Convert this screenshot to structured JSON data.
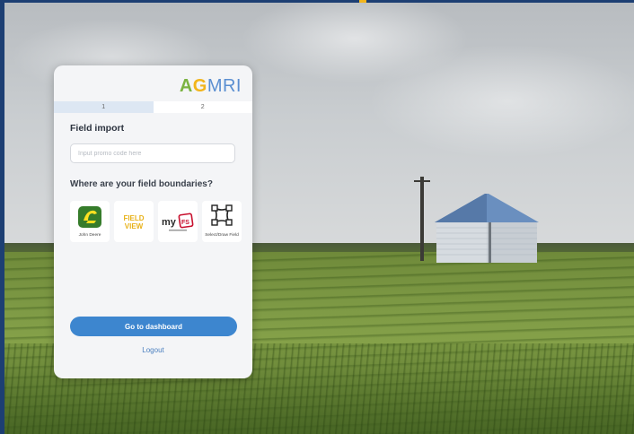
{
  "brand": {
    "logo_a": "A",
    "logo_g": "G",
    "logo_mri": "MRI"
  },
  "steps": [
    "1",
    "2"
  ],
  "field_import": {
    "title": "Field import",
    "input_placeholder": "Input promo code here"
  },
  "boundaries": {
    "question": "Where are your field boundaries?",
    "providers": [
      {
        "name": "John Deere",
        "icon": "john-deere-icon"
      },
      {
        "name": "FieldView",
        "icon": "fieldview-icon"
      },
      {
        "name": "myFS",
        "icon": "myfs-icon"
      },
      {
        "name": "Select/Draw Field",
        "icon": "select-draw-icon"
      }
    ]
  },
  "actions": {
    "dashboard_label": "Go to dashboard",
    "logout_label": "Logout"
  },
  "colors": {
    "primary": "#3d86cf",
    "logo_green": "#7cb342",
    "logo_yellow": "#f2b51c",
    "logo_blue": "#5b8fd1",
    "frame": "#1d3f73"
  }
}
